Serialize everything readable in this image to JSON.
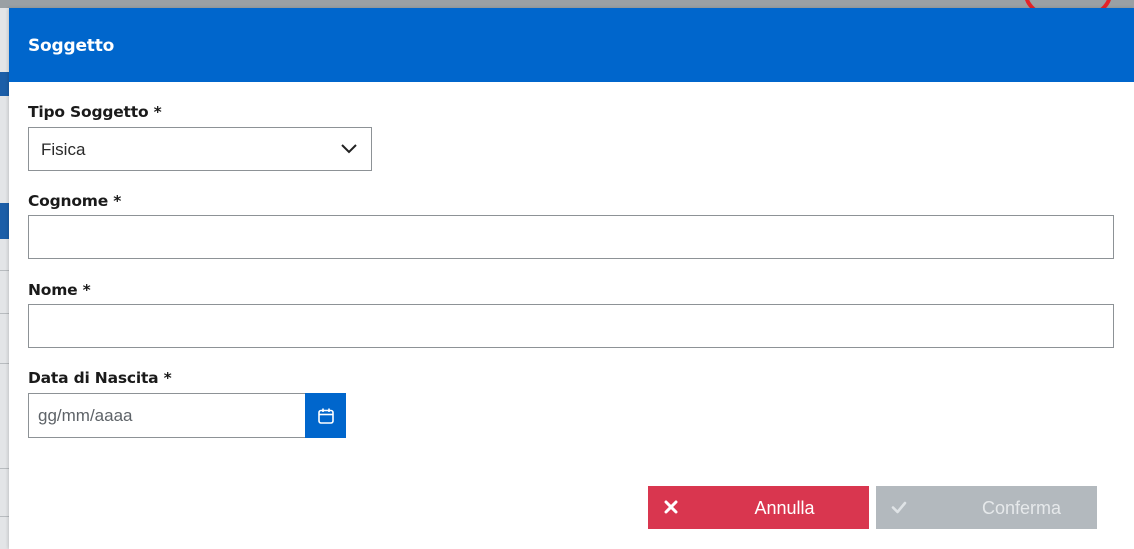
{
  "modal": {
    "title": "Soggetto"
  },
  "form": {
    "tipo_soggetto": {
      "label": "Tipo Soggetto *",
      "value": "Fisica"
    },
    "cognome": {
      "label": "Cognome *",
      "value": ""
    },
    "nome": {
      "label": "Nome *",
      "value": ""
    },
    "data_nascita": {
      "label": "Data di Nascita *",
      "placeholder": "gg/mm/aaaa",
      "value": ""
    }
  },
  "actions": {
    "cancel_label": "Annulla",
    "confirm_label": "Conferma"
  },
  "icons": {
    "select": "chevron-down-icon",
    "date": "calendar-icon",
    "cancel": "close-icon",
    "confirm": "check-icon"
  },
  "colors": {
    "primary": "#0066cc",
    "cancel": "#d9364f",
    "disabled": "#b3b9be"
  }
}
